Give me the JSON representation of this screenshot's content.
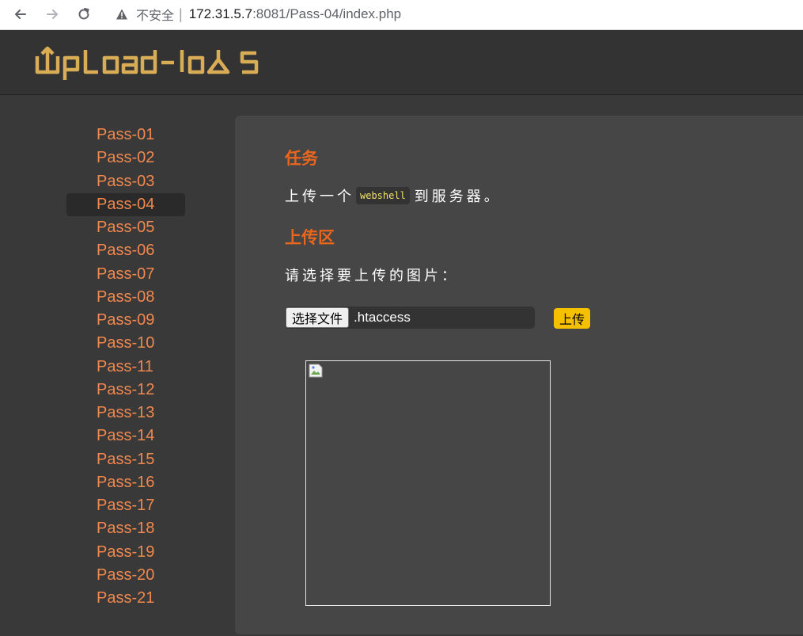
{
  "browser": {
    "security_label": "不安全",
    "separator": "|",
    "url_host": "172.31.5.7",
    "url_rest": ":8081/Pass-04/index.php"
  },
  "site": {
    "logo_text": "UpLoad-labs"
  },
  "sidebar": {
    "active": "Pass-04",
    "items": [
      "Pass-01",
      "Pass-02",
      "Pass-03",
      "Pass-04",
      "Pass-05",
      "Pass-06",
      "Pass-07",
      "Pass-08",
      "Pass-09",
      "Pass-10",
      "Pass-11",
      "Pass-12",
      "Pass-13",
      "Pass-14",
      "Pass-15",
      "Pass-16",
      "Pass-17",
      "Pass-18",
      "Pass-19",
      "Pass-20",
      "Pass-21"
    ]
  },
  "main": {
    "task_heading": "任务",
    "task_prefix": "上传一个",
    "task_code": "webshell",
    "task_suffix": "到服务器。",
    "upload_heading": "上传区",
    "choose_label": "请选择要上传的图片：",
    "file_button": "选择文件",
    "file_name": ".htaccess",
    "upload_button": "上传"
  },
  "colors": {
    "accent_orange": "#e8661e",
    "link_orange": "#f1884e",
    "upload_yellow": "#f5c000",
    "logo_gold": "#d9ad55"
  }
}
